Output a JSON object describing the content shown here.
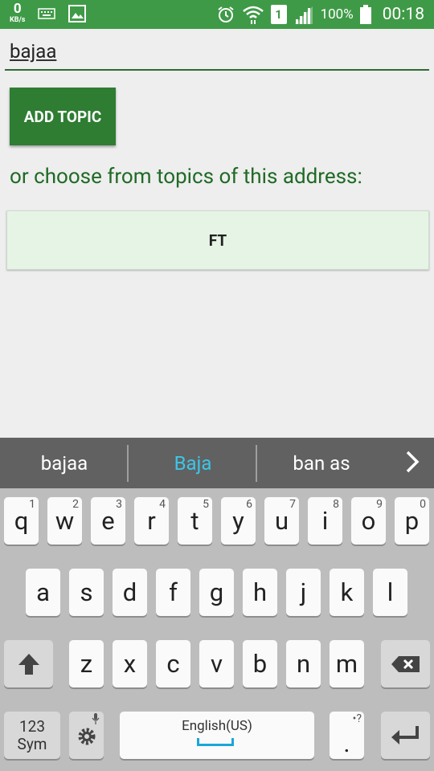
{
  "status_bar": {
    "net_speed": "0",
    "net_unit": "KB/s",
    "sim": "1",
    "battery": "100%",
    "time": "00:18"
  },
  "form": {
    "topic_value": "bajaa",
    "add_button": "ADD TOPIC",
    "choose_label": "or choose from topics of this address:",
    "topics": [
      "FT"
    ]
  },
  "suggestions": {
    "items": [
      "bajaa",
      "Baja",
      "ban as"
    ],
    "highlight_color": "#3cc6e8"
  },
  "keyboard": {
    "row1": [
      {
        "key": "q",
        "hint": "1"
      },
      {
        "key": "w",
        "hint": "2"
      },
      {
        "key": "e",
        "hint": "3"
      },
      {
        "key": "r",
        "hint": "4"
      },
      {
        "key": "t",
        "hint": "5"
      },
      {
        "key": "y",
        "hint": "6"
      },
      {
        "key": "u",
        "hint": "7"
      },
      {
        "key": "i",
        "hint": "8"
      },
      {
        "key": "o",
        "hint": "9"
      },
      {
        "key": "p",
        "hint": "0"
      }
    ],
    "row2": [
      "a",
      "s",
      "d",
      "f",
      "g",
      "h",
      "j",
      "k",
      "l"
    ],
    "row3": [
      "z",
      "x",
      "c",
      "v",
      "b",
      "n",
      "m"
    ],
    "sym_line1": "123",
    "sym_line2": "Sym",
    "space_label": "English(US)",
    "period": ".",
    "period_hint": "•?"
  },
  "colors": {
    "status_bar": "#3f9a47",
    "button": "#2e7d32",
    "label": "#1f6a25",
    "topic_bg": "#e6f4e6"
  }
}
